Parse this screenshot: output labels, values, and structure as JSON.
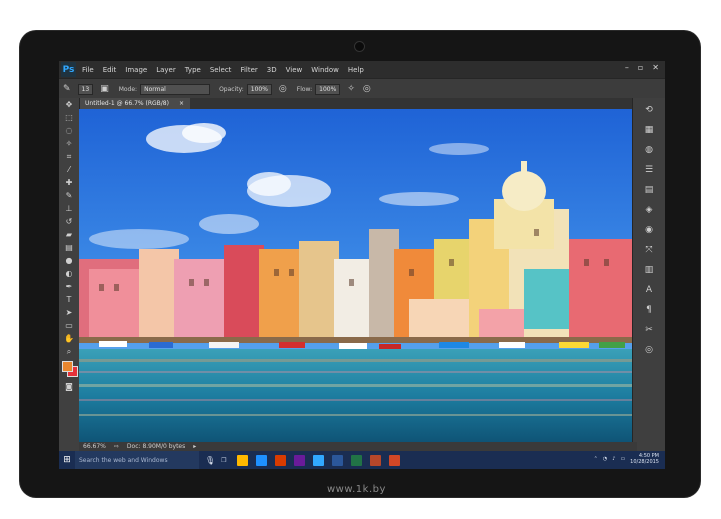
{
  "app": {
    "logo": "Ps",
    "menu": [
      "File",
      "Edit",
      "Image",
      "Layer",
      "Type",
      "Select",
      "Filter",
      "3D",
      "View",
      "Window",
      "Help"
    ],
    "window_controls": [
      "–",
      "▫",
      "✕"
    ]
  },
  "options": {
    "brush_size": "13",
    "mode_label": "Mode:",
    "mode_value": "Normal",
    "opacity_label": "Opacity:",
    "opacity_value": "100%",
    "flow_label": "Flow:",
    "flow_value": "100%"
  },
  "document": {
    "tab_title": "Untitled-1 @ 66.7% (RGB/8)",
    "tab_close": "×"
  },
  "status": {
    "zoom": "66.67%",
    "doc_size": "Doc: 8.90M/0 bytes"
  },
  "taskbar": {
    "search_placeholder": "Search the web and Windows",
    "time": "4:50 PM",
    "date": "10/28/2015",
    "app_colors": [
      "#ffb900",
      "#1e90ff",
      "#d83b01",
      "#6a1b9a",
      "#31a8ff",
      "#2b579a",
      "#217346",
      "#b7472a",
      "#d24726"
    ]
  },
  "colors": {
    "foreground": "#e8862f",
    "background": "#e5313a",
    "ps_accent": "#31a8ff"
  },
  "watermark": "www.1k.by"
}
